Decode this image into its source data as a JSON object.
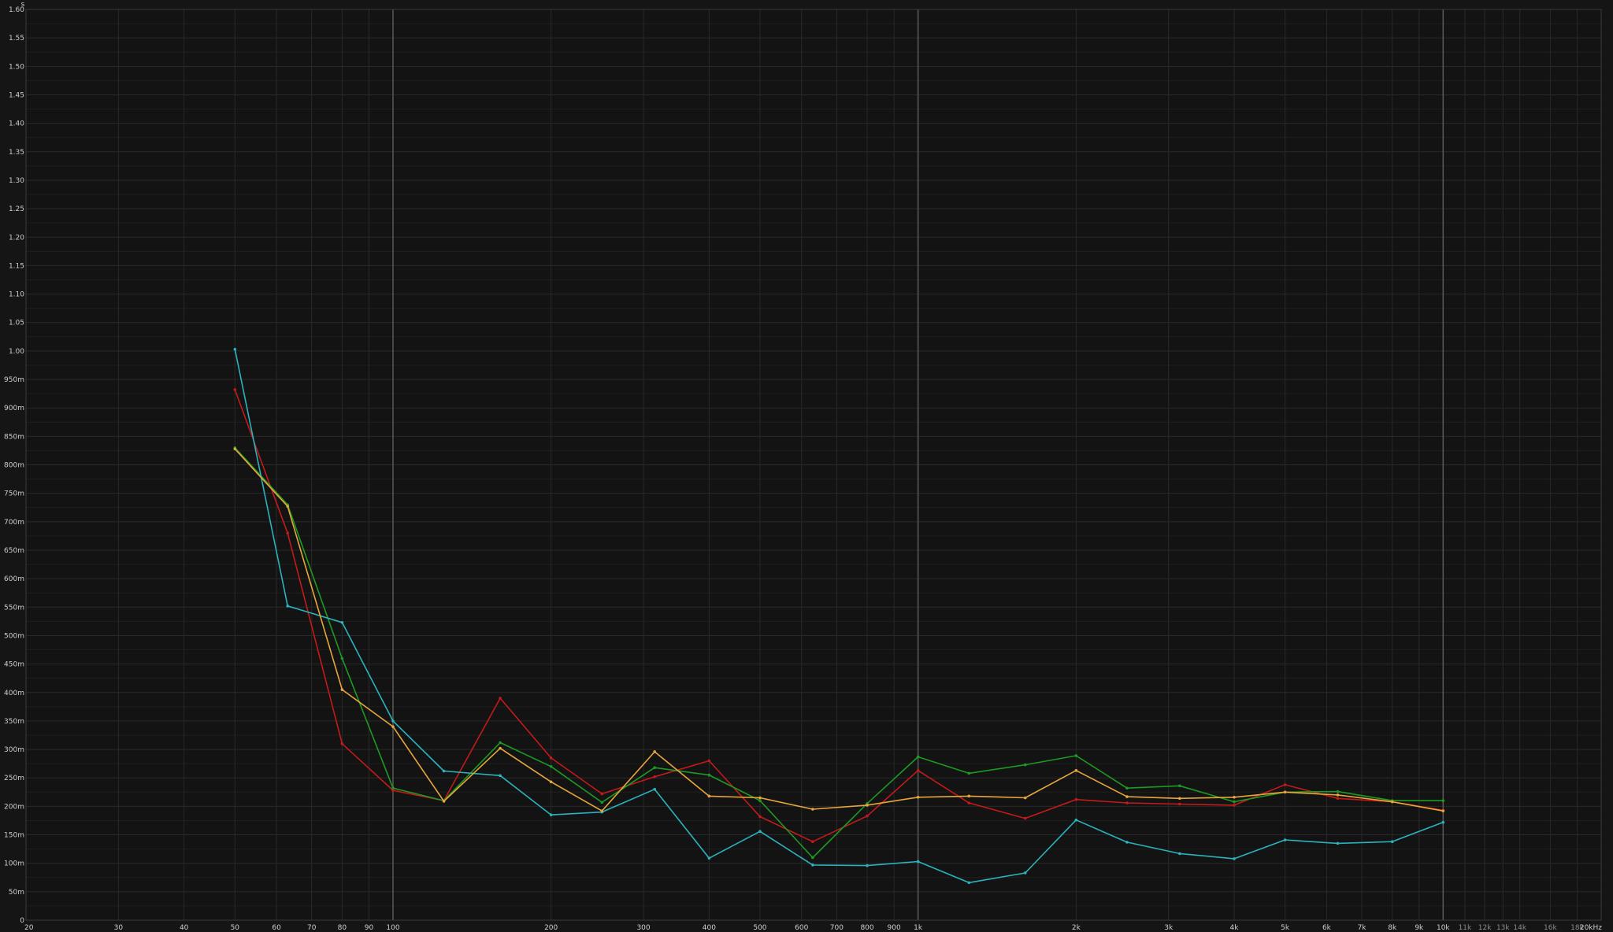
{
  "chart_data": {
    "type": "line",
    "x_scale": "log",
    "xlim": [
      20,
      20000
    ],
    "ylim": [
      0,
      1.6
    ],
    "y_unit_label": "s",
    "grid": true,
    "x_ticks": [
      {
        "v": 20,
        "label": "20"
      },
      {
        "v": 30,
        "label": "30"
      },
      {
        "v": 40,
        "label": "40"
      },
      {
        "v": 50,
        "label": "50"
      },
      {
        "v": 60,
        "label": "60"
      },
      {
        "v": 70,
        "label": "70"
      },
      {
        "v": 80,
        "label": "80"
      },
      {
        "v": 90,
        "label": "90"
      },
      {
        "v": 100,
        "label": "100"
      },
      {
        "v": 200,
        "label": "200"
      },
      {
        "v": 300,
        "label": "300"
      },
      {
        "v": 400,
        "label": "400"
      },
      {
        "v": 500,
        "label": "500"
      },
      {
        "v": 600,
        "label": "600"
      },
      {
        "v": 700,
        "label": "700"
      },
      {
        "v": 800,
        "label": "800"
      },
      {
        "v": 900,
        "label": "900"
      },
      {
        "v": 1000,
        "label": "1k"
      },
      {
        "v": 2000,
        "label": "2k"
      },
      {
        "v": 3000,
        "label": "3k"
      },
      {
        "v": 4000,
        "label": "4k"
      },
      {
        "v": 5000,
        "label": "5k"
      },
      {
        "v": 6000,
        "label": "6k"
      },
      {
        "v": 7000,
        "label": "7k"
      },
      {
        "v": 8000,
        "label": "8k"
      },
      {
        "v": 9000,
        "label": "9k"
      },
      {
        "v": 10000,
        "label": "10k"
      },
      {
        "v": 11000,
        "label": "11k",
        "dim": true
      },
      {
        "v": 12000,
        "label": "12k",
        "dim": true
      },
      {
        "v": 13000,
        "label": "13k",
        "dim": true
      },
      {
        "v": 14000,
        "label": "14k",
        "dim": true
      },
      {
        "v": 16000,
        "label": "16k",
        "dim": true
      },
      {
        "v": 18000,
        "label": "18k",
        "dim": true
      },
      {
        "v": 20000,
        "label": "20kHz"
      }
    ],
    "y_ticks": [
      {
        "v": 0,
        "label": "0"
      },
      {
        "v": 0.05,
        "label": "50m"
      },
      {
        "v": 0.1,
        "label": "100m"
      },
      {
        "v": 0.15,
        "label": "150m"
      },
      {
        "v": 0.2,
        "label": "200m"
      },
      {
        "v": 0.25,
        "label": "250m"
      },
      {
        "v": 0.3,
        "label": "300m"
      },
      {
        "v": 0.35,
        "label": "350m"
      },
      {
        "v": 0.4,
        "label": "400m"
      },
      {
        "v": 0.45,
        "label": "450m"
      },
      {
        "v": 0.5,
        "label": "500m"
      },
      {
        "v": 0.55,
        "label": "550m"
      },
      {
        "v": 0.6,
        "label": "600m"
      },
      {
        "v": 0.65,
        "label": "650m"
      },
      {
        "v": 0.7,
        "label": "700m"
      },
      {
        "v": 0.75,
        "label": "750m"
      },
      {
        "v": 0.8,
        "label": "800m"
      },
      {
        "v": 0.85,
        "label": "850m"
      },
      {
        "v": 0.9,
        "label": "900m"
      },
      {
        "v": 0.95,
        "label": "950m"
      },
      {
        "v": 1.0,
        "label": "1.00"
      },
      {
        "v": 1.05,
        "label": "1.05"
      },
      {
        "v": 1.1,
        "label": "1.10"
      },
      {
        "v": 1.15,
        "label": "1.15"
      },
      {
        "v": 1.2,
        "label": "1.20"
      },
      {
        "v": 1.25,
        "label": "1.25"
      },
      {
        "v": 1.3,
        "label": "1.30"
      },
      {
        "v": 1.35,
        "label": "1.35"
      },
      {
        "v": 1.4,
        "label": "1.40"
      },
      {
        "v": 1.45,
        "label": "1.45"
      },
      {
        "v": 1.5,
        "label": "1.50"
      },
      {
        "v": 1.55,
        "label": "1.55"
      },
      {
        "v": 1.6,
        "label": "1.60"
      }
    ],
    "x": [
      50,
      63,
      80,
      100,
      125,
      160,
      200,
      250,
      315,
      400,
      500,
      630,
      800,
      1000,
      1250,
      1600,
      2000,
      2500,
      3150,
      4000,
      5000,
      6300,
      8000,
      10000
    ],
    "series": [
      {
        "color": "#c41a1a",
        "values": [
          0.932,
          0.68,
          0.31,
          0.228,
          0.21,
          0.39,
          0.285,
          0.222,
          0.252,
          0.28,
          0.182,
          0.138,
          0.183,
          0.263,
          0.206,
          0.179,
          0.212,
          0.206,
          0.204,
          0.202,
          0.238,
          0.214,
          0.208,
          0.193
        ]
      },
      {
        "color": "#1d9a22",
        "values": [
          0.83,
          0.73,
          0.46,
          0.232,
          0.21,
          0.312,
          0.27,
          0.207,
          0.268,
          0.255,
          0.21,
          0.11,
          0.205,
          0.287,
          0.258,
          0.273,
          0.289,
          0.232,
          0.236,
          0.208,
          0.225,
          0.226,
          0.21,
          0.21
        ]
      },
      {
        "color": "#2bb3bd",
        "values": [
          1.003,
          0.552,
          0.523,
          0.35,
          0.262,
          0.254,
          0.185,
          0.19,
          0.23,
          0.109,
          0.156,
          0.097,
          0.096,
          0.103,
          0.066,
          0.083,
          0.176,
          0.137,
          0.117,
          0.108,
          0.141,
          0.135,
          0.138,
          0.172
        ]
      },
      {
        "color": "#e7a63c",
        "values": [
          0.828,
          0.727,
          0.405,
          0.34,
          0.209,
          0.302,
          0.243,
          0.192,
          0.296,
          0.218,
          0.215,
          0.195,
          0.202,
          0.216,
          0.218,
          0.215,
          0.263,
          0.217,
          0.214,
          0.216,
          0.225,
          0.22,
          0.208,
          0.192
        ]
      }
    ]
  }
}
